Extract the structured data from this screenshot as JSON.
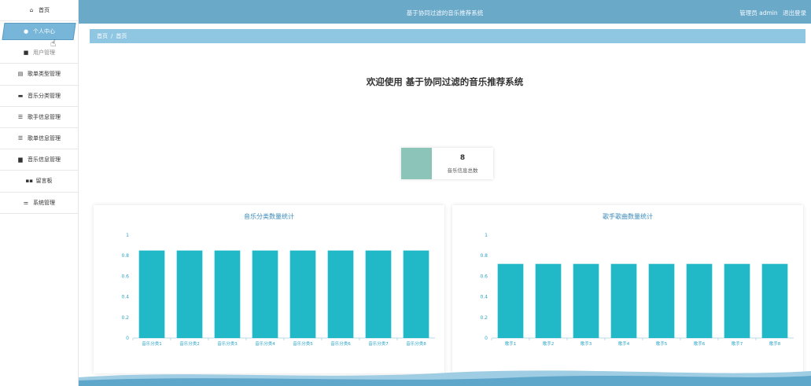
{
  "app_title": "基于协同过滤的音乐推荐系统",
  "header": {
    "user_label": "管理员 admin",
    "logout_label": "退出登录"
  },
  "sidebar": {
    "items": [
      {
        "label": "首页",
        "icon": "home-icon",
        "glyph": "⌂"
      },
      {
        "label": "个人中心",
        "icon": "person-icon",
        "glyph": "●",
        "active": true
      },
      {
        "label": "用户管理",
        "icon": "briefcase-icon",
        "glyph": "■"
      },
      {
        "label": "歌单类型管理",
        "icon": "clipboard-icon",
        "glyph": "▤"
      },
      {
        "label": "音乐分类管理",
        "icon": "monitor-icon",
        "glyph": "▬"
      },
      {
        "label": "歌手信息管理",
        "icon": "list-icon",
        "glyph": "☰"
      },
      {
        "label": "歌单信息管理",
        "icon": "list-icon",
        "glyph": "☰"
      },
      {
        "label": "音乐信息管理",
        "icon": "document-icon",
        "glyph": "▆"
      },
      {
        "label": "留言板",
        "icon": "grid-icon",
        "glyph": "▪▪"
      },
      {
        "label": "系统管理",
        "icon": "sliders-icon",
        "glyph": "⚌"
      }
    ]
  },
  "breadcrumb": {
    "root": "首页",
    "separator": "/",
    "current": "首页"
  },
  "welcome": "欢迎使用 基于协同过滤的音乐推荐系统",
  "stat_card": {
    "value": "8",
    "label": "音乐信息总数",
    "color": "#8cc4b9"
  },
  "colors": {
    "topbar": "#6ba9c9",
    "breadcrumb": "#8fc6e2",
    "bar": "#21b8c8",
    "axis_text": "#2aa3c7"
  },
  "chart_data": [
    {
      "type": "bar",
      "title": "音乐分类数量统计",
      "categories": [
        "音乐分类1",
        "音乐分类2",
        "音乐分类3",
        "音乐分类4",
        "音乐分类5",
        "音乐分类6",
        "音乐分类7",
        "音乐分类8"
      ],
      "values": [
        0.85,
        0.85,
        0.85,
        0.85,
        0.85,
        0.85,
        0.85,
        0.85
      ],
      "y_ticks": [
        "0",
        "0.2",
        "0.4",
        "0.6",
        "0.8",
        "1"
      ],
      "ylim": [
        0,
        1
      ],
      "grid": false
    },
    {
      "type": "bar",
      "title": "歌手歌曲数量统计",
      "categories": [
        "歌手1",
        "歌手2",
        "歌手3",
        "歌手4",
        "歌手5",
        "歌手6",
        "歌手7",
        "歌手8"
      ],
      "values": [
        0.72,
        0.72,
        0.72,
        0.72,
        0.72,
        0.72,
        0.72,
        0.72
      ],
      "y_ticks": [
        "0",
        "0.2",
        "0.4",
        "0.6",
        "0.8",
        "1"
      ],
      "ylim": [
        0,
        1
      ],
      "grid": false
    }
  ]
}
